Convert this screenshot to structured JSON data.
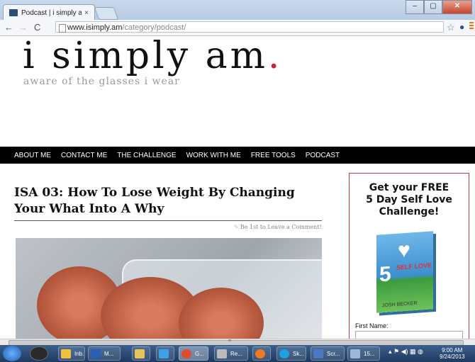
{
  "browser": {
    "tab_title": "Podcast | i simply am",
    "tab_close": "×",
    "url_domain": "www.isimply.am",
    "url_path": "/category/podcast/",
    "window_buttons": [
      "–",
      "▢",
      "✕"
    ]
  },
  "site": {
    "title": "i simply am",
    "title_dot": ".",
    "tagline": "aware of the glasses i wear"
  },
  "nav": [
    "ABOUT ME",
    "CONTACT ME",
    "THE CHALLENGE",
    "WORK WITH ME",
    "FREE TOOLS",
    "PODCAST"
  ],
  "post": {
    "title": "ISA 03: How To Lose Weight By Changing Your What Into A Why",
    "comment_link": "Be 1st to Leave a Comment!"
  },
  "sidebar": {
    "promo_line1": "Get your FREE",
    "promo_line2": "5 Day Self Love",
    "promo_line3": "Challenge!",
    "book_number": "5",
    "book_title": "SELF LOVE",
    "book_author": "JOSH BECKER",
    "first_name_label": "First Name:"
  },
  "taskbar": {
    "items": [
      "Inb...",
      "M...",
      "",
      "",
      "G...",
      "Re...",
      "",
      "Sk...",
      "Scr...",
      "15..."
    ],
    "time": "9:00 AM",
    "date": "9/24/2013"
  }
}
